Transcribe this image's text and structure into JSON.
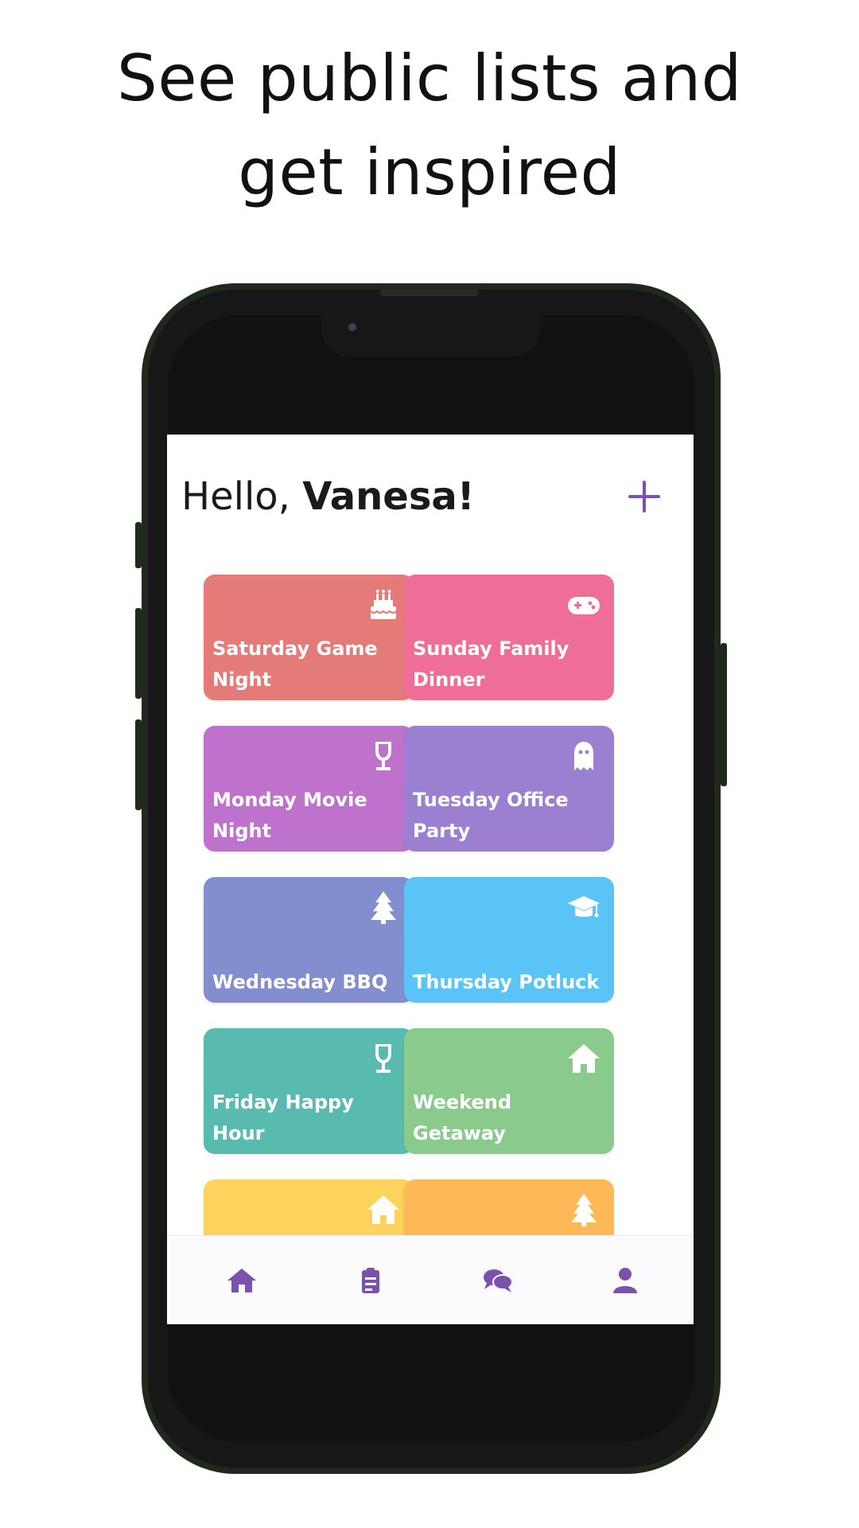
{
  "promo": {
    "line1": "See public lists and",
    "line2": "get inspired"
  },
  "header": {
    "greeting_prefix": "Hello,",
    "greeting_name": "Vanesa!"
  },
  "lists": [
    {
      "title": "Saturday Game Night",
      "icon": "cake-icon",
      "color": "#e57b78"
    },
    {
      "title": "Sunday Family Dinner",
      "icon": "gamepad-icon",
      "color": "#ee6e98"
    },
    {
      "title": "Monday Movie Night",
      "icon": "wine-glass-icon",
      "color": "#bf72cc"
    },
    {
      "title": "Tuesday Office Party",
      "icon": "ghost-icon",
      "color": "#9b80d1"
    },
    {
      "title": "Wednesday BBQ",
      "icon": "tree-icon",
      "color": "#838ecf"
    },
    {
      "title": "Thursday Potluck",
      "icon": "graduation-cap-icon",
      "color": "#5bc4f7"
    },
    {
      "title": "Friday Happy Hour",
      "icon": "wine-glass-icon",
      "color": "#59bbb0"
    },
    {
      "title": "Weekend Getaway",
      "icon": "home-icon",
      "color": "#8acb8d"
    },
    {
      "title": "",
      "icon": "home-icon",
      "color": "#fdd35b"
    },
    {
      "title": "",
      "icon": "tree-icon",
      "color": "#fdb858"
    }
  ],
  "tabbar": {
    "items": [
      "home-icon",
      "clipboard-icon",
      "chat-icon",
      "user-icon"
    ],
    "accent": "#7b52ab"
  }
}
